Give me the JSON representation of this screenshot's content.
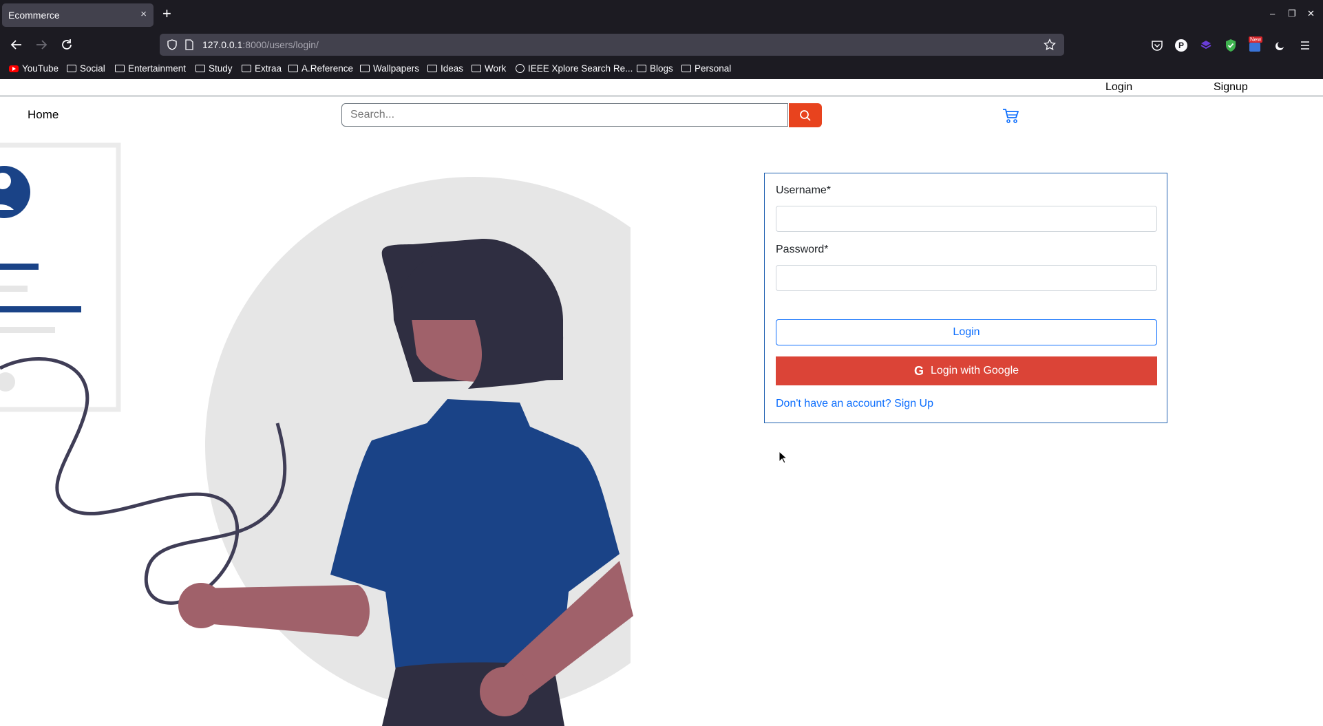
{
  "browser": {
    "tab_title": "Ecommerce",
    "tab_close": "×",
    "new_tab": "+",
    "url_host": "127.0.0.1",
    "url_rest": ":8000/users/login/",
    "window_controls": [
      "–",
      "❐",
      "✕"
    ],
    "bookmarks": [
      {
        "label": "YouTube",
        "icon": "youtube-icon"
      },
      {
        "label": "Social",
        "icon": "folder-icon"
      },
      {
        "label": "Entertainment",
        "icon": "folder-icon"
      },
      {
        "label": "Study",
        "icon": "folder-icon"
      },
      {
        "label": "Extraa",
        "icon": "folder-icon"
      },
      {
        "label": "A.Reference",
        "icon": "folder-icon"
      },
      {
        "label": "Wallpapers",
        "icon": "folder-icon"
      },
      {
        "label": "Ideas",
        "icon": "folder-icon"
      },
      {
        "label": "Work",
        "icon": "folder-icon"
      },
      {
        "label": "IEEE Xplore Search Re...",
        "icon": "globe-icon"
      },
      {
        "label": "Blogs",
        "icon": "folder-icon"
      },
      {
        "label": "Personal",
        "icon": "folder-icon"
      }
    ],
    "extension_badge": "New"
  },
  "site": {
    "top_links": {
      "login": "Login",
      "signup": "Signup"
    },
    "nav": {
      "home": "Home"
    },
    "search": {
      "placeholder": "Search..."
    },
    "colors": {
      "accent_blue": "#0d6efd",
      "search_button": "#e8431e",
      "google_red": "#db4437",
      "illustration_blue": "#1a4387"
    }
  },
  "login_form": {
    "username_label": "Username*",
    "password_label": "Password*",
    "login_button": "Login",
    "google_button": "Login with Google",
    "google_icon_glyph": "G",
    "signup_link": "Don't have an account? Sign Up"
  }
}
